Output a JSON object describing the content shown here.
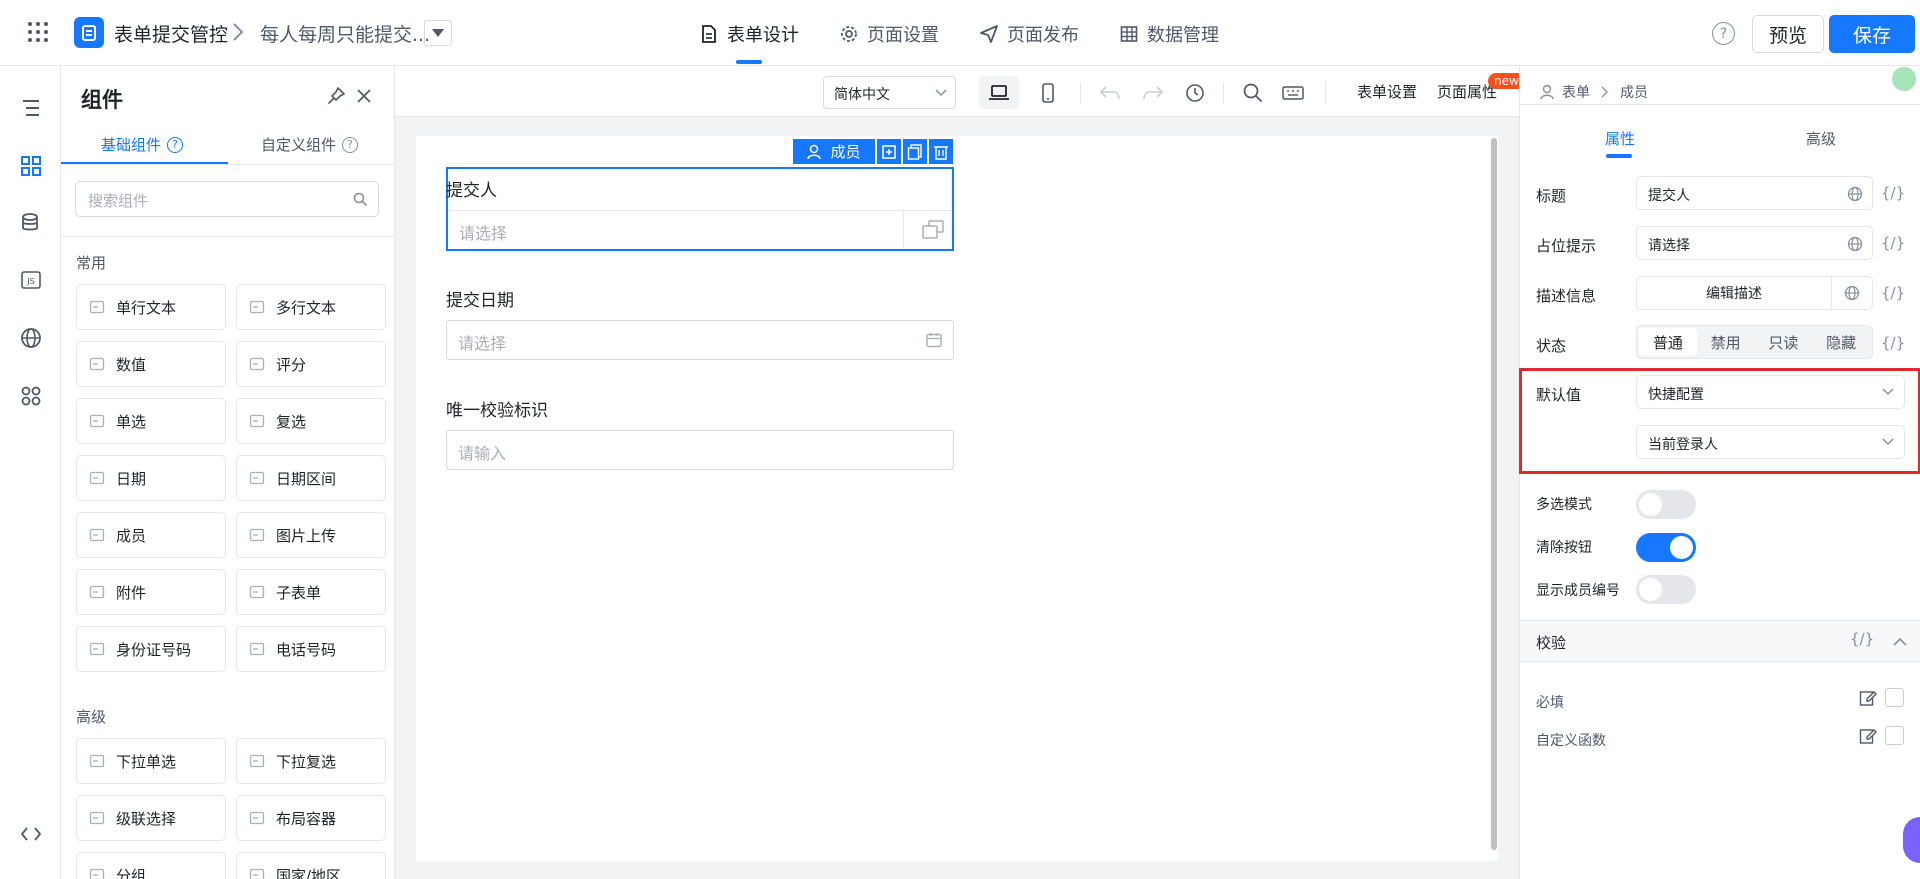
{
  "topbar": {
    "app_name": "表单提交管控",
    "breadcrumb_page": "每人每周只能提交...",
    "tabs": [
      {
        "label": "表单设计"
      },
      {
        "label": "页面设置"
      },
      {
        "label": "页面发布"
      },
      {
        "label": "数据管理"
      }
    ],
    "help_label": "?",
    "preview_label": "预览",
    "save_label": "保存",
    "accent": "#1677ff"
  },
  "panel": {
    "title": "组件",
    "tab_basic": "基础组件",
    "tab_custom": "自定义组件",
    "search_placeholder": "搜索组件",
    "section_common": "常用",
    "common": [
      {
        "label": "单行文本"
      },
      {
        "label": "多行文本"
      },
      {
        "label": "数值"
      },
      {
        "label": "评分"
      },
      {
        "label": "单选"
      },
      {
        "label": "复选"
      },
      {
        "label": "日期"
      },
      {
        "label": "日期区间"
      },
      {
        "label": "成员"
      },
      {
        "label": "图片上传"
      },
      {
        "label": "附件"
      },
      {
        "label": "子表单"
      },
      {
        "label": "身份证号码"
      },
      {
        "label": "电话号码"
      }
    ],
    "section_advanced": "高级",
    "advanced": [
      {
        "label": "下拉单选"
      },
      {
        "label": "下拉复选"
      },
      {
        "label": "级联选择"
      },
      {
        "label": "布局容器"
      },
      {
        "label": "分组"
      },
      {
        "label": "国家/地区"
      }
    ]
  },
  "toolbar": {
    "language": "简体中文",
    "form_settings": "表单设置",
    "page_props": "页面属性",
    "new_badge": "new"
  },
  "canvas": {
    "selected_badge": "成员",
    "fields": [
      {
        "label": "提交人",
        "placeholder": "请选择"
      },
      {
        "label": "提交日期",
        "placeholder": "请选择"
      },
      {
        "label": "唯一校验标识",
        "placeholder": "请输入"
      }
    ]
  },
  "props": {
    "breadcrumb_form": "表单",
    "breadcrumb_member": "成员",
    "tab_props": "属性",
    "tab_advanced": "高级",
    "fx": "{/}",
    "title_label": "标题",
    "title_value": "提交人",
    "placeholder_label": "占位提示",
    "placeholder_value": "请选择",
    "desc_label": "描述信息",
    "desc_button": "编辑描述",
    "status_label": "状态",
    "status_options": [
      "普通",
      "禁用",
      "只读",
      "隐藏"
    ],
    "status_selected": "普通",
    "default_label": "默认值",
    "default_mode": "快捷配置",
    "default_value": "当前登录人",
    "multi_label": "多选模式",
    "multi_on": false,
    "clear_label": "清除按钮",
    "clear_on": true,
    "show_id_label": "显示成员编号",
    "show_id_on": false,
    "validate_label": "校验",
    "required_label": "必填",
    "custom_func_label": "自定义函数"
  }
}
